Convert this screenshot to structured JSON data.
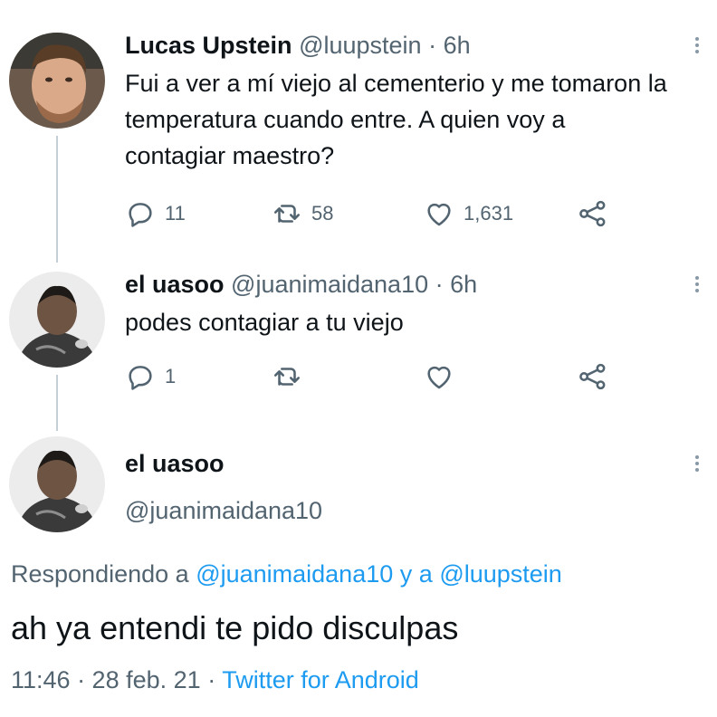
{
  "tweet1": {
    "name": "Lucas Upstein",
    "handle": "@luupstein",
    "dot": "·",
    "time": "6h",
    "text": "Fui a ver a mí viejo al cementerio y me tomaron la temperatura cuando entre. A quien voy a contagiar maestro?",
    "reply_count": "11",
    "retweet_count": "58",
    "like_count": "1,631"
  },
  "tweet2": {
    "name": "el uasoo",
    "handle": "@juanimaidana10",
    "dot": "·",
    "time": "6h",
    "text": "podes contagiar a tu viejo",
    "reply_count": "1"
  },
  "main_tweet": {
    "name": "el uasoo",
    "handle": "@juanimaidana10",
    "replying_prefix": "Respondiendo a",
    "mention1": "@juanimaidana10",
    "replying_and": "y a",
    "mention2": "@luupstein",
    "text": "ah ya entendi te pido disculpas",
    "timestamp": "11:46 · 28 feb. 21",
    "separator": "·",
    "source": "Twitter for Android"
  },
  "icons": {
    "reply": "reply-icon",
    "retweet": "retweet-icon",
    "like": "heart-icon",
    "share": "share-icon",
    "more": "more-vertical-icon"
  },
  "colors": {
    "text_primary": "#0f1419",
    "text_secondary": "#536471",
    "link": "#1d9bf0",
    "thread_line": "#c4cfd6"
  }
}
